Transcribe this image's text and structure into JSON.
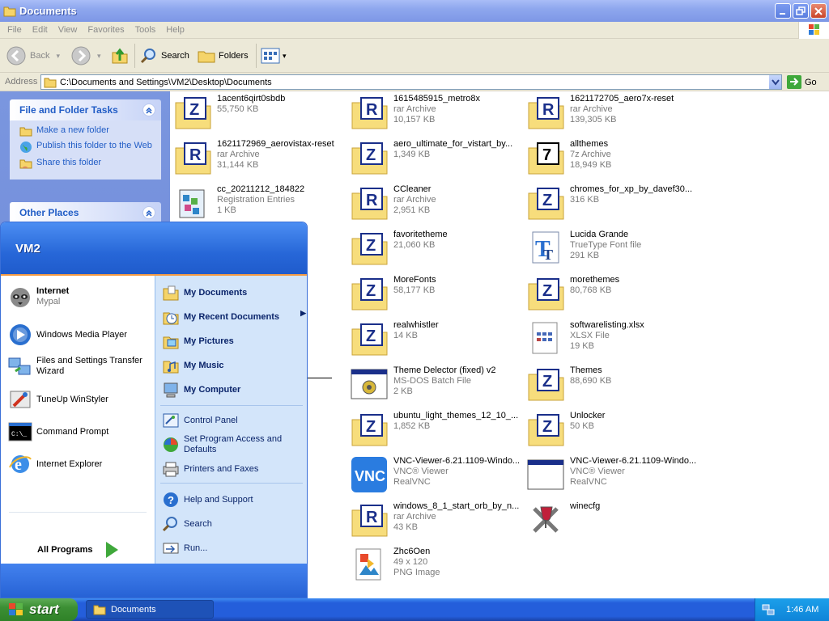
{
  "window": {
    "title": "Documents"
  },
  "menu": {
    "items": [
      "File",
      "Edit",
      "View",
      "Favorites",
      "Tools",
      "Help"
    ]
  },
  "toolbar": {
    "back_label": "Back",
    "search_label": "Search",
    "folders_label": "Folders"
  },
  "address": {
    "label": "Address",
    "value": "C:\\Documents and Settings\\VM2\\Desktop\\Documents",
    "go_label": "Go"
  },
  "tasks": {
    "file_folder_title": "File and Folder Tasks",
    "links": [
      "Make a new folder",
      "Publish this folder to the Web",
      "Share this folder"
    ],
    "other_places_title": "Other Places"
  },
  "files": [
    {
      "name": "1acent6qirt0sbdb",
      "type": "",
      "size": "55,750 KB",
      "icon": "zip-folder-icon"
    },
    {
      "name": "1615485915_metro8x",
      "type": "rar Archive",
      "size": "10,157 KB",
      "icon": "rar-folder-icon"
    },
    {
      "name": "1621172705_aero7x-reset",
      "type": "rar Archive",
      "size": "139,305 KB",
      "icon": "rar-folder-icon"
    },
    {
      "name": "1621172969_aerovistax-reset",
      "type": "rar Archive",
      "size": "31,144 KB",
      "icon": "rar-folder-icon"
    },
    {
      "name": "aero_ultimate_for_vistart_by...",
      "type": "",
      "size": "1,349 KB",
      "icon": "zip-folder-icon"
    },
    {
      "name": "allthemes",
      "type": "7z Archive",
      "size": "18,949 KB",
      "icon": "7z-folder-icon"
    },
    {
      "name": "cc_20211212_184822",
      "type": "Registration Entries",
      "size": "1 KB",
      "icon": "registry-icon"
    },
    {
      "name": "CCleaner",
      "type": "rar Archive",
      "size": "2,951 KB",
      "icon": "rar-folder-icon"
    },
    {
      "name": "chromes_for_xp_by_davef30...",
      "type": "",
      "size": "316 KB",
      "icon": "zip-folder-icon"
    },
    {
      "name": "favoritetheme",
      "type": "",
      "size": "21,060 KB",
      "icon": "zip-folder-icon"
    },
    {
      "name": "Lucida Grande",
      "type": "TrueType Font file",
      "size": "291 KB",
      "icon": "font-icon"
    },
    {
      "name": "MoreFonts",
      "type": "",
      "size": "58,177 KB",
      "icon": "zip-folder-icon"
    },
    {
      "name": "morethemes",
      "type": "",
      "size": "80,768 KB",
      "icon": "zip-folder-icon"
    },
    {
      "name": "realwhistler",
      "type": "",
      "size": "14 KB",
      "icon": "zip-folder-icon"
    },
    {
      "name": "softwarelisting.xlsx",
      "type": "XLSX File",
      "size": "19 KB",
      "icon": "xlsx-file-icon"
    },
    {
      "name": "Theme Delector (fixed) v2",
      "type": "MS-DOS Batch File",
      "size": "2 KB",
      "icon": "batch-file-icon"
    },
    {
      "name": "Themes",
      "type": "",
      "size": "88,690 KB",
      "icon": "zip-folder-icon"
    },
    {
      "name": "ubuntu_light_themes_12_10_...",
      "type": "",
      "size": "1,852 KB",
      "icon": "zip-folder-icon"
    },
    {
      "name": "Unlocker",
      "type": "",
      "size": "50 KB",
      "icon": "zip-folder-icon"
    },
    {
      "name": "VNC-Viewer-6.21.1109-Windo...",
      "type": "VNC® Viewer",
      "size": "RealVNC",
      "icon": "vnc-icon"
    },
    {
      "name": "VNC-Viewer-6.21.1109-Windo...",
      "type": "VNC® Viewer",
      "size": "RealVNC",
      "icon": "window-app-icon"
    },
    {
      "name": "windows_8_1_start_orb_by_n...",
      "type": "rar Archive",
      "size": "43 KB",
      "icon": "rar-folder-icon"
    },
    {
      "name": "winecfg",
      "type": "",
      "size": "",
      "icon": "winecfg-icon"
    },
    {
      "name": "Zhc6Oen",
      "type": "49 x 120",
      "size": "PNG Image",
      "icon": "png-image-icon"
    }
  ],
  "start_menu": {
    "user": "VM2",
    "internet": {
      "title": "Internet",
      "sub": "Mypal"
    },
    "left_items": [
      "Windows Media Player",
      "Files and Settings Transfer Wizard",
      "TuneUp WinStyler",
      "Command Prompt",
      "Internet Explorer"
    ],
    "all_programs": "All Programs",
    "right_items_bold": [
      "My Documents",
      "My Recent Documents",
      "My Pictures",
      "My Music",
      "My Computer"
    ],
    "right_items": [
      "Control Panel",
      "Set Program Access and Defaults",
      "Printers and Faxes",
      "Help and Support",
      "Search",
      "Run..."
    ]
  },
  "taskbar": {
    "start_label": "start",
    "task_label": "Documents",
    "clock": "1:46 AM"
  }
}
